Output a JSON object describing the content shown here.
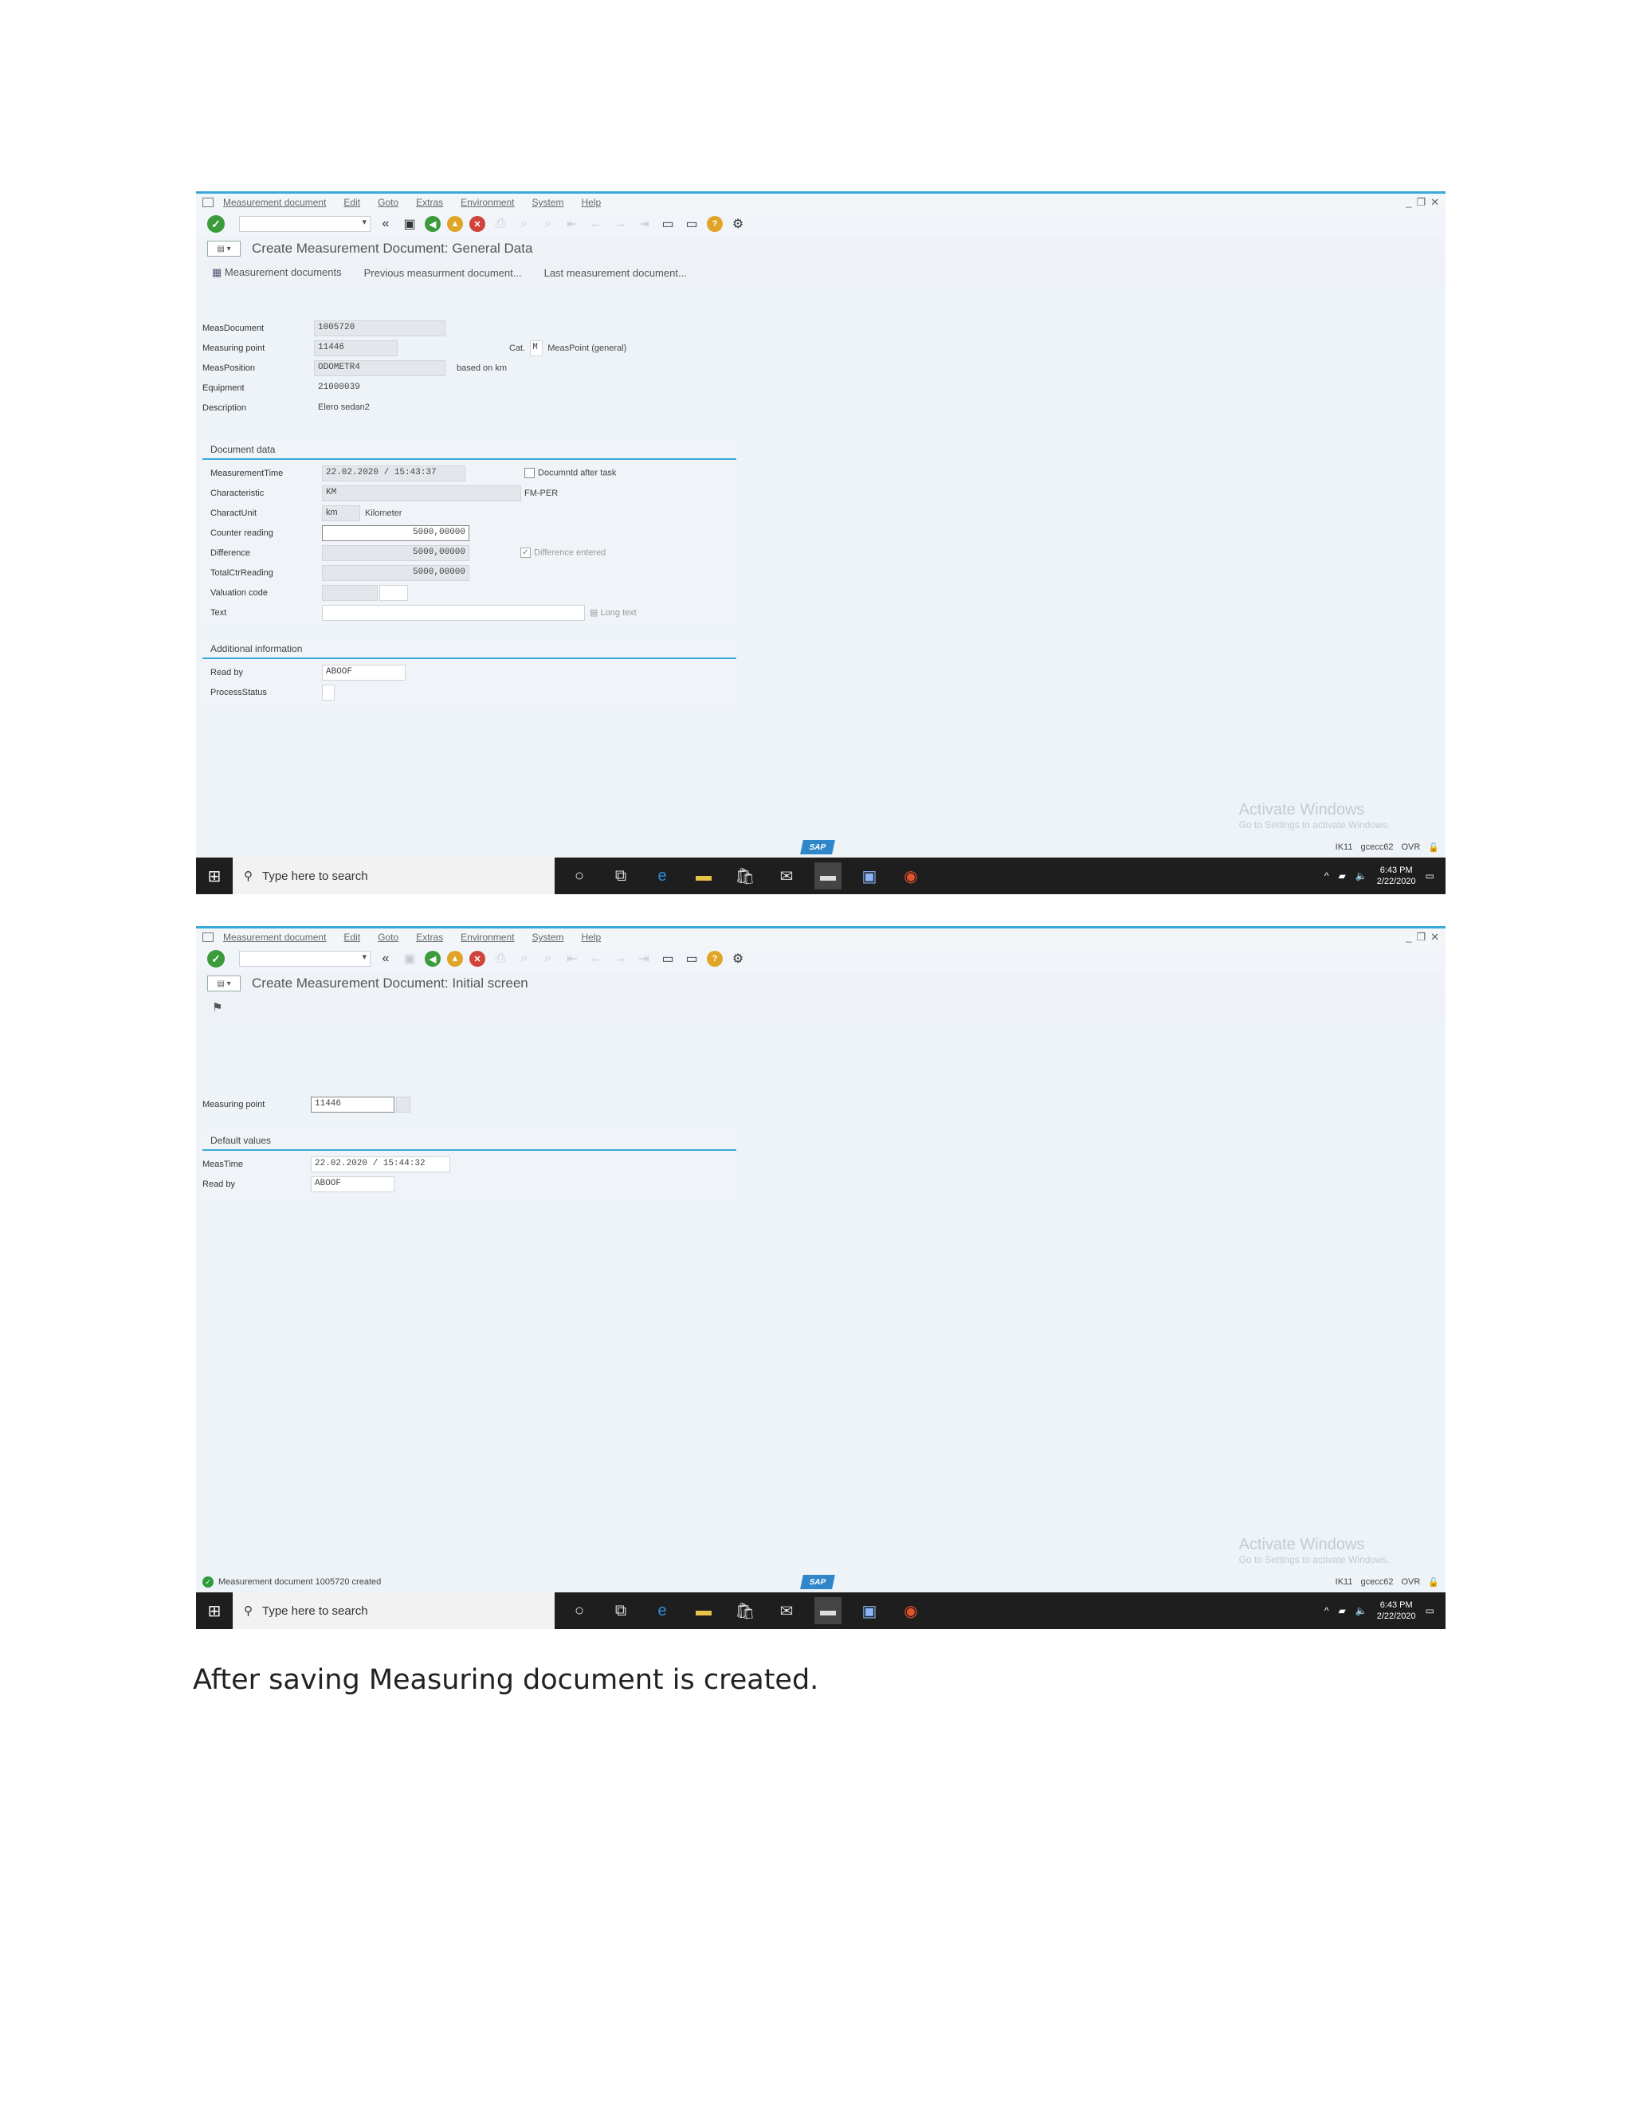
{
  "menu": {
    "items": [
      "Measurement document",
      "Edit",
      "Goto",
      "Extras",
      "Environment",
      "System",
      "Help"
    ]
  },
  "toolbar": {
    "command_value": "▾"
  },
  "screen1": {
    "title": "Create Measurement Document: General Data",
    "app_toolbar": [
      "Measurement documents",
      "Previous measurment document...",
      "Last measurement document..."
    ],
    "header_fields": [
      {
        "label": "MeasDocument",
        "value": "1005720"
      },
      {
        "label": "Measuring point",
        "value": "11446"
      },
      {
        "label": "MeasPosition",
        "value": "ODOMETR4"
      },
      {
        "label": "Equipment",
        "value": "21000039"
      },
      {
        "label": "Description",
        "value": "Elero sedan2"
      }
    ],
    "cat_label": "Cat.",
    "cat_value": "M",
    "cat_text": "MeasPoint (general)",
    "based_on": "based on km",
    "doc_group_title": "Document data",
    "doc_fields": [
      {
        "label": "MeasurementTime",
        "value": "22.02.2020 / 15:43:37"
      },
      {
        "label": "Characteristic",
        "value": "KM"
      },
      {
        "label": "CharactUnit",
        "value": "km",
        "extra": "Kilometer"
      },
      {
        "label": "Counter reading",
        "value": "5000,00000"
      },
      {
        "label": "Difference",
        "value": "5000,00000"
      },
      {
        "label": "TotalCtrReading",
        "value": "5000,00000"
      },
      {
        "label": "Valuation code",
        "value": ""
      },
      {
        "label": "Text",
        "value": ""
      }
    ],
    "documented_after_task": "Documntd after task",
    "char_side": "FM-PER",
    "difference_entered": "Difference entered",
    "long_text": "Long text",
    "add_group_title": "Additional information",
    "add_fields": [
      {
        "label": "Read by",
        "value": "ABOOF"
      },
      {
        "label": "ProcessStatus",
        "value": ""
      }
    ],
    "status_message": ""
  },
  "screen2": {
    "title": "Create Measurement Document: Initial screen",
    "measuring_point_label": "Measuring point",
    "measuring_point_value": "11446",
    "default_group_title": "Default values",
    "default_fields": [
      {
        "label": "MeasTime",
        "value": "22.02.2020 / 15:44:32"
      },
      {
        "label": "Read by",
        "value": "ABOOF"
      }
    ],
    "status_message": "Measurement document 1005720 created"
  },
  "statusbar": {
    "sap_logo": "SAP",
    "system": "IK11",
    "client": "gcecc62",
    "mode": "OVR"
  },
  "watermark": {
    "title": "Activate Windows",
    "sub": "Go to Settings to activate Windows."
  },
  "taskbar": {
    "search_placeholder": "Type here to search",
    "time": "6:43 PM",
    "date": "2/22/2020"
  },
  "caption": "After saving Measuring document is created.",
  "colors": {
    "accent": "#39a8db",
    "ok": "#3a9b3a",
    "back": "#3a9b3a",
    "exit": "#e0a526",
    "cancel": "#d0443a",
    "help": "#e0a526"
  }
}
